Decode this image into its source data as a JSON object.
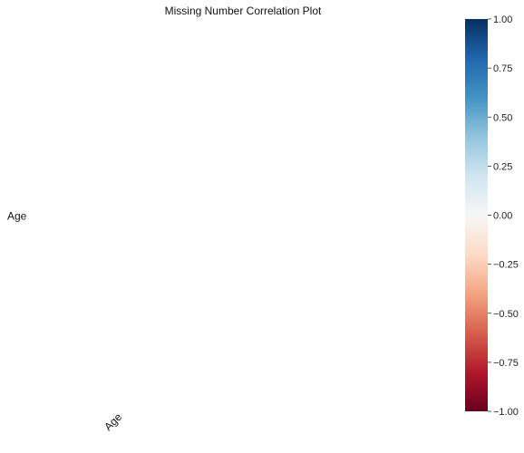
{
  "chart_data": {
    "type": "heatmap",
    "title": "Missing Number Correlation Plot",
    "row_labels": [
      "Age"
    ],
    "col_labels": [
      "Age"
    ],
    "values": [
      [
        null
      ]
    ],
    "xlabel": "",
    "ylabel": "",
    "colorbar": {
      "min": -1.0,
      "max": 1.0,
      "ticks": [
        1.0,
        0.75,
        0.5,
        0.25,
        0.0,
        -0.25,
        -0.5,
        -0.75,
        -1.0
      ],
      "tick_labels": [
        "1.00",
        "0.75",
        "0.50",
        "0.25",
        "0.00",
        "−0.25",
        "−0.50",
        "−0.75",
        "−1.00"
      ],
      "colormap": "RdBu",
      "stops": [
        "#67001f",
        "#b2182b",
        "#d6604d",
        "#f4a582",
        "#fddbc7",
        "#f7f7f7",
        "#d1e5f0",
        "#92c5de",
        "#4393c3",
        "#2166ac",
        "#053061"
      ]
    },
    "grid": false,
    "legend": "right"
  }
}
